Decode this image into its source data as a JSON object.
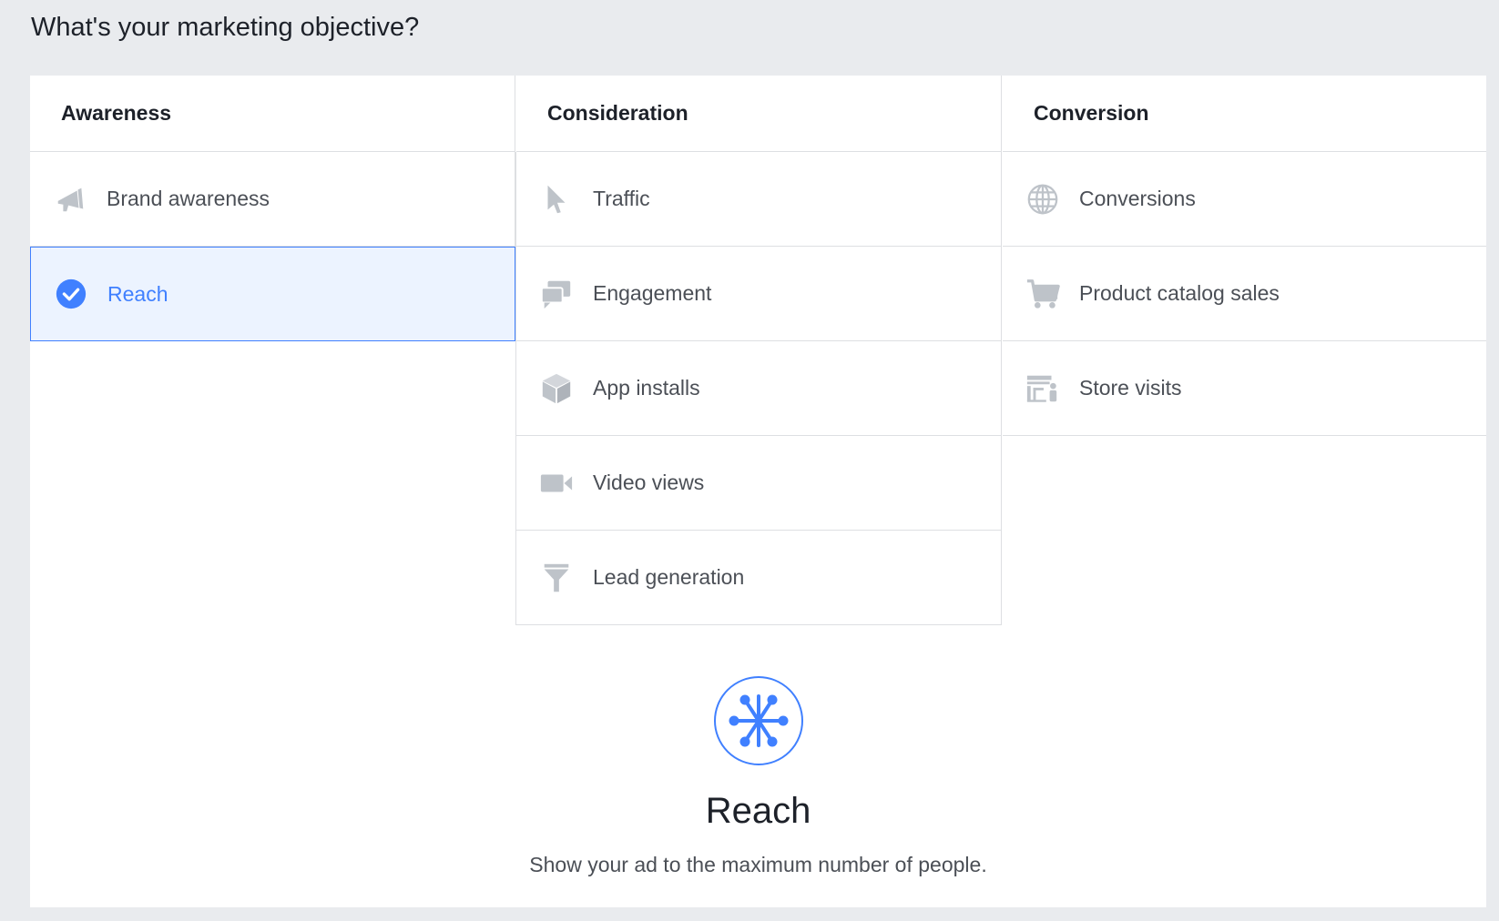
{
  "page": {
    "heading": "What's your marketing objective?"
  },
  "columns": [
    {
      "title": "Awareness",
      "items": [
        {
          "label": "Brand awareness",
          "icon": "megaphone-icon"
        },
        {
          "label": "Reach",
          "icon": "check-circle-icon",
          "selected": true
        }
      ]
    },
    {
      "title": "Consideration",
      "items": [
        {
          "label": "Traffic",
          "icon": "cursor-icon"
        },
        {
          "label": "Engagement",
          "icon": "chat-bubbles-icon"
        },
        {
          "label": "App installs",
          "icon": "cube-icon"
        },
        {
          "label": "Video views",
          "icon": "video-camera-icon"
        },
        {
          "label": "Lead generation",
          "icon": "funnel-icon"
        }
      ]
    },
    {
      "title": "Conversion",
      "items": [
        {
          "label": "Conversions",
          "icon": "globe-icon"
        },
        {
          "label": "Product catalog sales",
          "icon": "cart-icon"
        },
        {
          "label": "Store visits",
          "icon": "store-icon"
        }
      ]
    }
  ],
  "detail": {
    "icon": "reach-network-icon",
    "title": "Reach",
    "description": "Show your ad to the maximum number of people."
  },
  "colors": {
    "accent": "#4080ff",
    "icon_gray": "#bec3c9",
    "selected_bg": "#ecf3ff",
    "page_bg": "#e9ebee"
  }
}
